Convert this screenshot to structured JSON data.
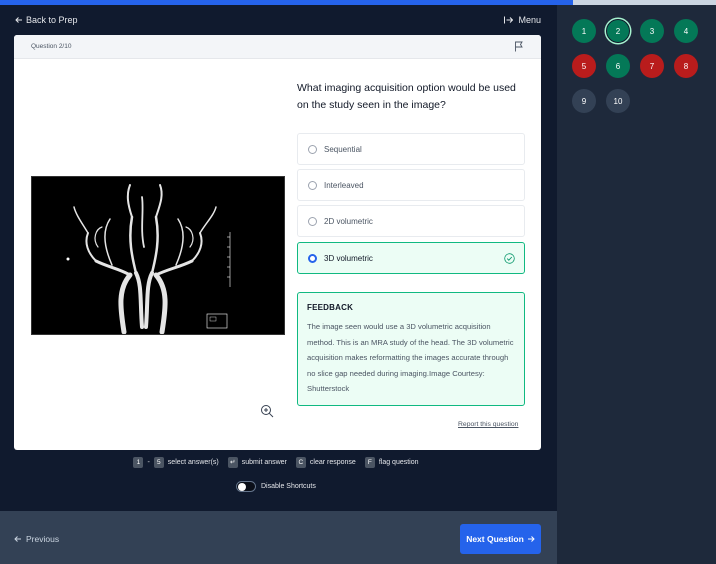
{
  "progress": {
    "fraction": 0.8,
    "accent": "#2563eb"
  },
  "nav": {
    "back_label": "Back to Prep",
    "menu_label": "Menu"
  },
  "question": {
    "number_label": "Question 2/10",
    "text": "What imaging acquisition option would be used on the study seen in the image?",
    "image_alt": "MRA of head",
    "options": [
      {
        "label": "Sequential",
        "selected": false
      },
      {
        "label": "Interleaved",
        "selected": false
      },
      {
        "label": "2D volumetric",
        "selected": false
      },
      {
        "label": "3D volumetric",
        "selected": true
      }
    ],
    "feedback_title": "FEEDBACK",
    "feedback_text": "The image seen would use a 3D volumetric acquisition method. This is an MRA study of the head. The 3D volumetric acquisition makes reformatting the images accurate through no slice gap needed during imaging.Image Courtesy: Shutterstock",
    "report_label": "Report this question"
  },
  "shortcuts": {
    "key_range_from": "1",
    "key_range_sep": "-",
    "key_range_to": "5",
    "select_label": "select answer(s)",
    "submit_key": "↵",
    "submit_label": "submit answer",
    "clear_key": "C",
    "clear_label": "clear response",
    "flag_key": "F",
    "flag_label": "flag question",
    "disable_label": "Disable Shortcuts"
  },
  "footer": {
    "previous_label": "Previous",
    "next_label": "Next Question"
  },
  "question_grid": [
    {
      "label": "1",
      "status": "correct"
    },
    {
      "label": "2",
      "status": "correct",
      "current": true
    },
    {
      "label": "3",
      "status": "correct"
    },
    {
      "label": "4",
      "status": "correct"
    },
    {
      "label": "5",
      "status": "incorrect"
    },
    {
      "label": "6",
      "status": "correct"
    },
    {
      "label": "7",
      "status": "incorrect"
    },
    {
      "label": "8",
      "status": "incorrect"
    },
    {
      "label": "9",
      "status": "unanswered"
    },
    {
      "label": "10",
      "status": "unanswered"
    }
  ],
  "colors": {
    "correct": "#047857",
    "incorrect": "#b91c1c",
    "unanswered": "#334155",
    "selected_border": "#10b981"
  }
}
